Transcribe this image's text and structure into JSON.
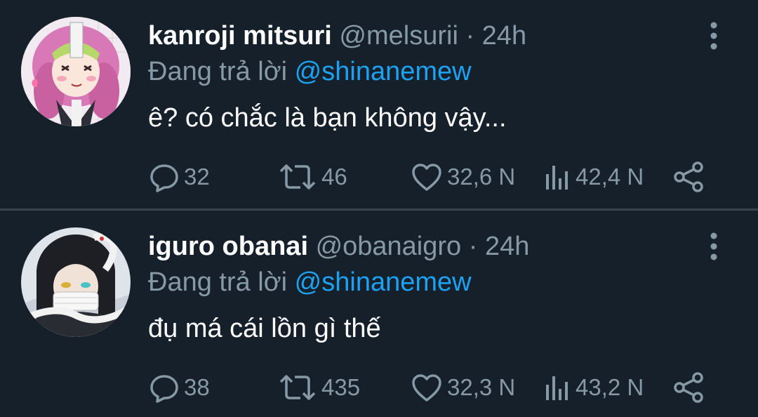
{
  "tweets": [
    {
      "display_name": "kanroji mitsuri",
      "handle": "@melsurii",
      "separator": "·",
      "time": "24h",
      "reply_prefix": "Đang trả lời",
      "reply_to": "@shinanemew",
      "text": "ê? có chắc là bạn không vậy...",
      "replies": "32",
      "retweets": "46",
      "likes": "32,6 N",
      "views": "42,4 N"
    },
    {
      "display_name": "iguro obanai",
      "handle": "@obanaigro",
      "separator": "·",
      "time": "24h",
      "reply_prefix": "Đang trả lời",
      "reply_to": "@shinanemew",
      "text": "đụ má cái lồn gì thế",
      "replies": "38",
      "retweets": "435",
      "likes": "32,3 N",
      "views": "43,2 N"
    }
  ],
  "colors": {
    "background": "#15202b",
    "text_primary": "#ffffff",
    "text_secondary": "#8899a6",
    "accent": "#1da1f2",
    "divider": "#38444d"
  },
  "icons": [
    "more-vertical-icon",
    "reply-icon",
    "retweet-icon",
    "like-icon",
    "views-icon",
    "share-icon"
  ]
}
